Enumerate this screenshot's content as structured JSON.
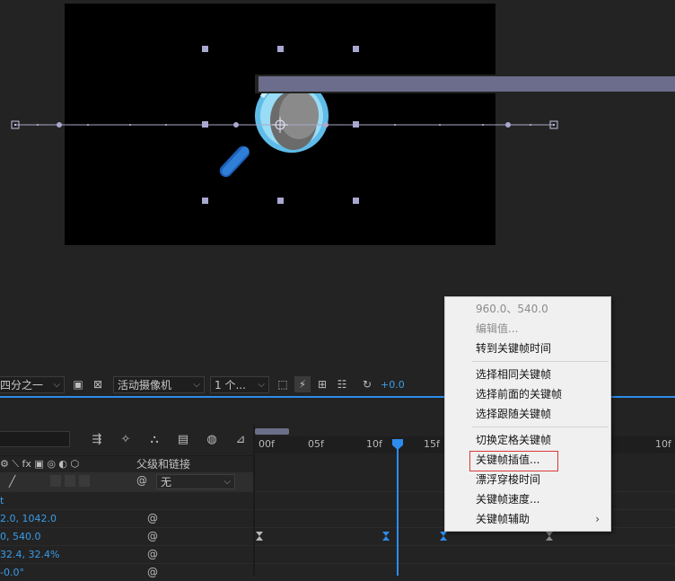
{
  "viewer_toolbar": {
    "resolution": "四分之一",
    "camera": "活动摄像机",
    "views": "1 个...",
    "exposure": "+0.0"
  },
  "timeline": {
    "parent_header": "父级和链接",
    "parent_value": "无",
    "ruler_ticks": [
      "00f",
      "05f",
      "10f",
      "15f",
      "10f"
    ],
    "properties": [
      {
        "value": "2.0, 1042.0"
      },
      {
        "value": "0, 540.0"
      },
      {
        "value": "32.4, 32.4%"
      },
      {
        "value": "-0.0°"
      }
    ],
    "row_label": "t"
  },
  "context_menu": {
    "items": [
      {
        "label": "960.0、540.0",
        "disabled": true
      },
      {
        "label": "编辑值...",
        "disabled": true
      },
      {
        "label": "转到关键帧时间",
        "disabled": false
      },
      {
        "label": "选择相同关键帧",
        "disabled": false
      },
      {
        "label": "选择前面的关键帧",
        "disabled": false
      },
      {
        "label": "选择跟随关键帧",
        "disabled": false
      },
      {
        "label": "切换定格关键帧",
        "disabled": false
      },
      {
        "label": "关键帧插值...",
        "disabled": false
      },
      {
        "label": "漂浮穿梭时间",
        "disabled": false
      },
      {
        "label": "关键帧速度...",
        "disabled": false
      },
      {
        "label": "关键帧辅助",
        "disabled": false
      }
    ],
    "submenu_arrow": "›"
  },
  "colors": {
    "accent": "#2d8ceb",
    "value_blue": "#3a9ce8",
    "highlight_red": "#d83a3a",
    "layer_bar": "#6c6c8c"
  },
  "icons": [
    "search-icon",
    "magnifier-graphic",
    "camera-icon",
    "spiral-link-icon",
    "keyframe-icon"
  ]
}
